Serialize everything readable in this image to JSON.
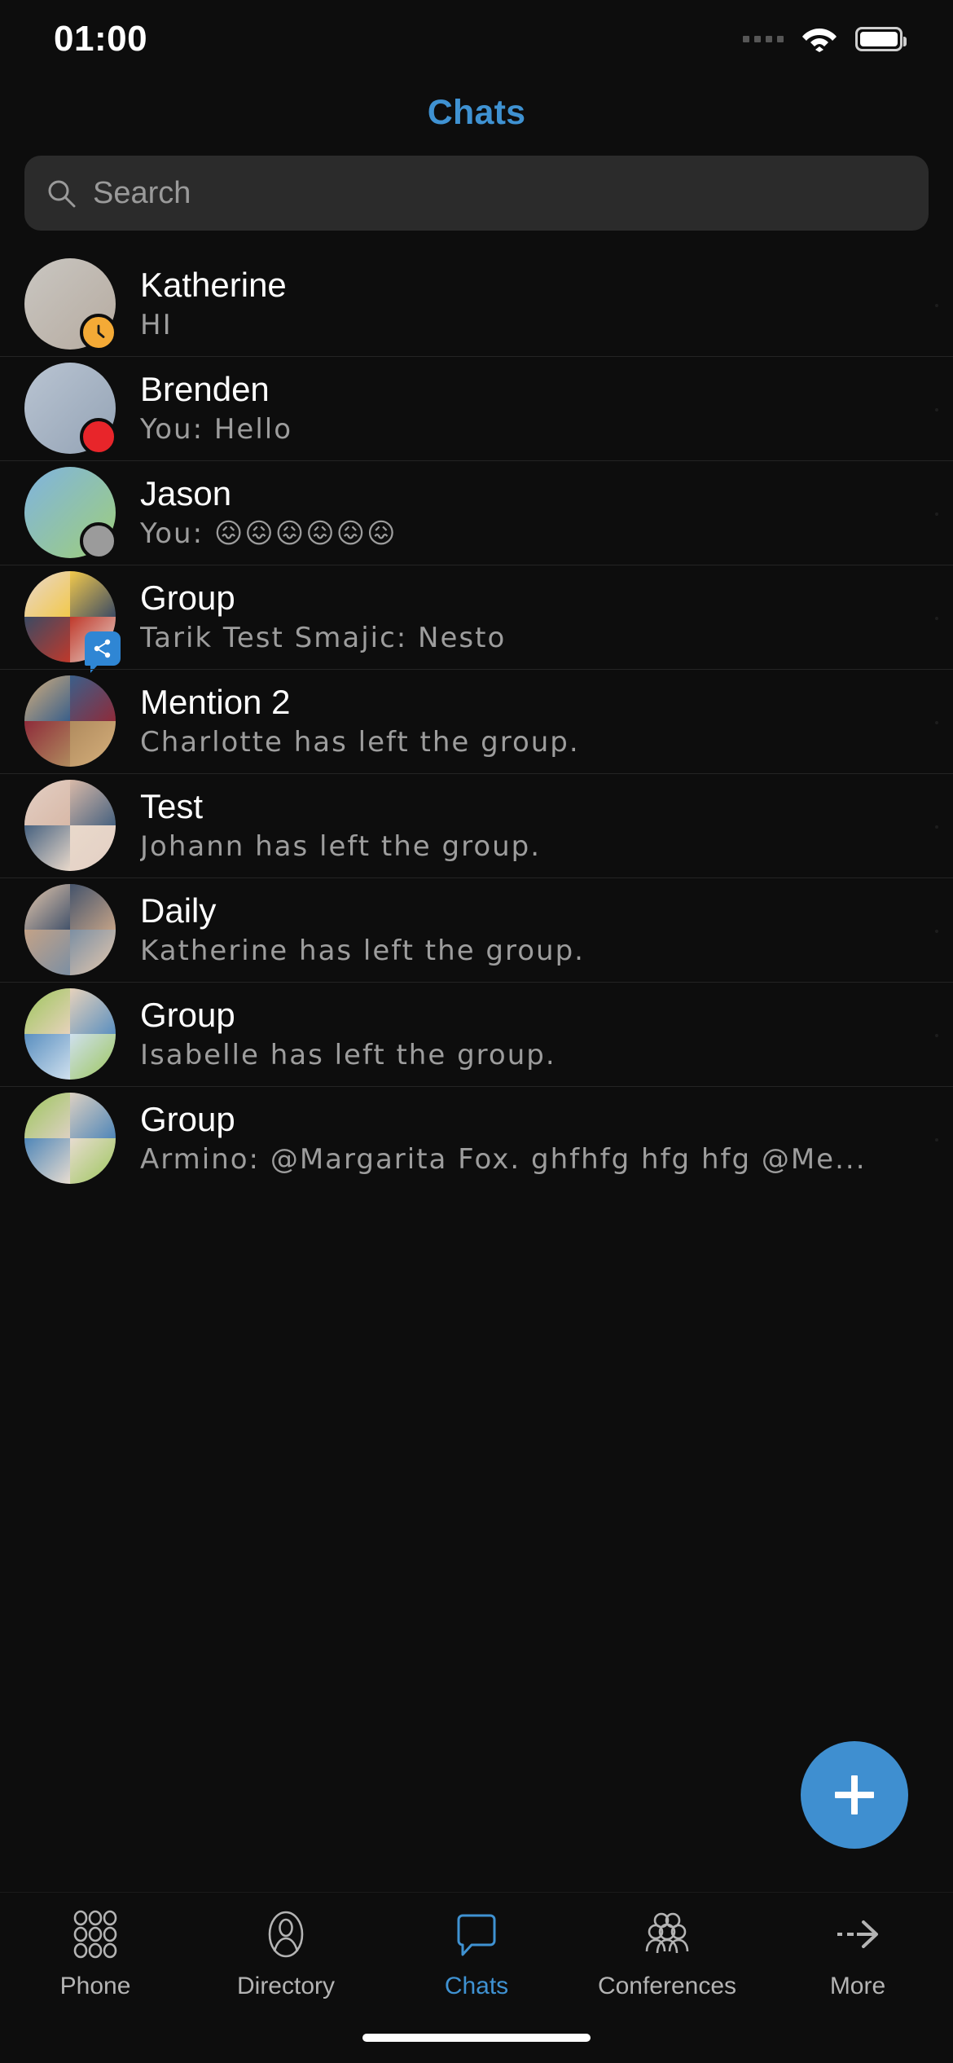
{
  "status_bar": {
    "time": "01:00",
    "signal_icon": "signal-dots-icon",
    "wifi_icon": "wifi-icon",
    "battery_icon": "battery-icon"
  },
  "header": {
    "title": "Chats"
  },
  "search": {
    "placeholder": "Search",
    "value": "",
    "icon": "search-icon"
  },
  "colors": {
    "accent": "#3f92d2",
    "fab": "#3f8fd0",
    "background": "#0d0d0d",
    "search_field": "#2b2b2b",
    "status_away": "#f4aa36",
    "status_busy": "#e8252a",
    "status_offline": "#9b9b9b",
    "group_badge": "#2f86d4",
    "primary_text": "#ffffff",
    "secondary_text": "#9d9d9d"
  },
  "chats": [
    {
      "name": "Katherine",
      "message": "HI",
      "avatar_type": "photo",
      "avatar_desc": "woman-portrait",
      "status": "away",
      "status_icon": "clock-icon"
    },
    {
      "name": "Brenden",
      "message": "You: Hello",
      "avatar_type": "photo",
      "avatar_desc": "man-on-phone-portrait",
      "status": "busy",
      "status_icon": "busy-dot-icon"
    },
    {
      "name": "Jason",
      "message": "You: 😖😖😖😖😖😖",
      "avatar_type": "photo",
      "avatar_desc": "city-park-monument",
      "status": "offline",
      "status_icon": "offline-dot-icon"
    },
    {
      "name": "Group",
      "message": "Tarik Test Smajic: Nesto",
      "avatar_type": "collage",
      "avatar_desc": "four-tile-group-collage",
      "status": "group",
      "status_icon": "group-share-icon"
    },
    {
      "name": "Mention 2",
      "message": "Charlotte has left the group.",
      "avatar_type": "collage",
      "avatar_desc": "four-tile-group-collage",
      "status": "none",
      "status_icon": ""
    },
    {
      "name": "Test",
      "message": "Johann has left the group.",
      "avatar_type": "collage",
      "avatar_desc": "four-tile-group-collage",
      "status": "none",
      "status_icon": ""
    },
    {
      "name": "Daily",
      "message": "Katherine has left the group.",
      "avatar_type": "collage",
      "avatar_desc": "four-tile-group-collage",
      "status": "none",
      "status_icon": ""
    },
    {
      "name": "Group",
      "message": "Isabelle has left the group.",
      "avatar_type": "collage",
      "avatar_desc": "four-tile-illustration-collage",
      "status": "none",
      "status_icon": ""
    },
    {
      "name": "Group",
      "message": "Armino: @Margarita Fox. ghfhfg hfg hfg @Me...",
      "avatar_type": "collage",
      "avatar_desc": "four-tile-illustration-collage",
      "status": "none",
      "status_icon": ""
    }
  ],
  "fab": {
    "label": "+",
    "icon": "plus-icon"
  },
  "tabbar": {
    "items": [
      {
        "label": "Phone",
        "icon": "dialpad-icon",
        "active": false
      },
      {
        "label": "Directory",
        "icon": "person-icon",
        "active": false
      },
      {
        "label": "Chats",
        "icon": "chat-bubble-icon",
        "active": true
      },
      {
        "label": "Conferences",
        "icon": "people-group-icon",
        "active": false
      },
      {
        "label": "More",
        "icon": "arrow-right-icon",
        "active": false
      }
    ]
  }
}
